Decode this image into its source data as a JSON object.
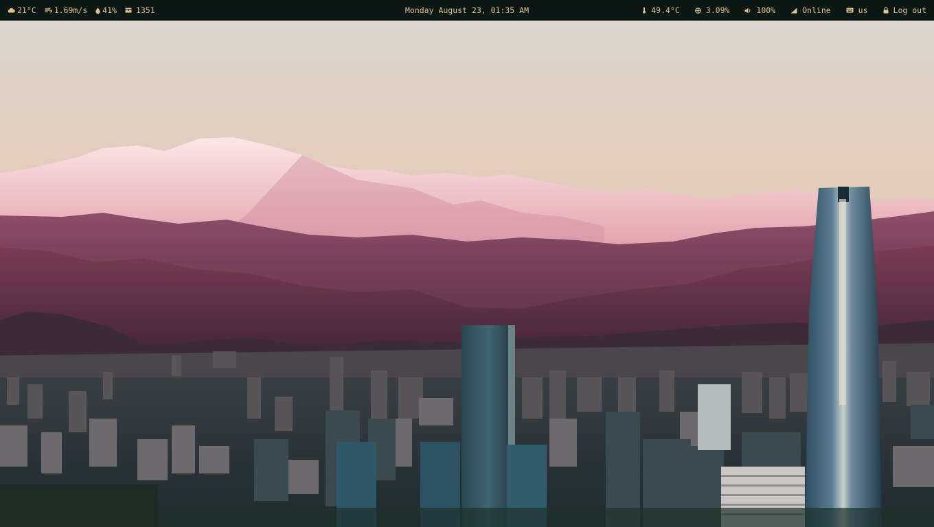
{
  "topbar": {
    "left": {
      "weather": {
        "icon": "cloud-icon",
        "text": "21°C"
      },
      "wind": {
        "icon": "wind-icon",
        "text": "1.69m/s"
      },
      "humidity": {
        "icon": "droplet-icon",
        "text": "41%"
      },
      "updates": {
        "icon": "package-icon",
        "text": "1351"
      }
    },
    "clock": "Monday August 23, 01:35 AM",
    "right": {
      "temperature": {
        "icon": "thermometer-icon",
        "text": "49.4°C"
      },
      "cpu": {
        "icon": "cpu-icon",
        "text": "3.09%"
      },
      "volume": {
        "icon": "speaker-icon",
        "text": "100%"
      },
      "network": {
        "icon": "wifi-signal-icon",
        "text": "Online"
      },
      "keyboard": {
        "icon": "keyboard-icon",
        "text": "us"
      },
      "logout": {
        "icon": "lock-icon",
        "text": "Log out"
      }
    }
  },
  "colors": {
    "bar_background": "#0b1713",
    "bar_text": "#e2c28f"
  },
  "wallpaper": {
    "subject": "city-skyline-with-snowy-mountains"
  }
}
